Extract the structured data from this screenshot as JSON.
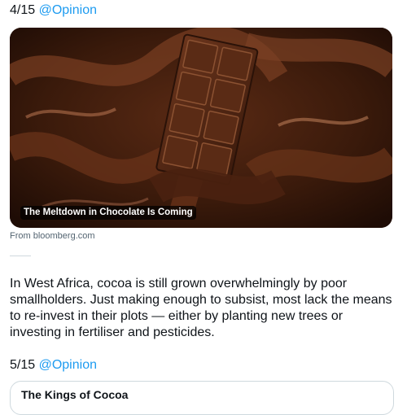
{
  "post4": {
    "index": "4/15",
    "mention": "@Opinion",
    "card_title": "The Meltdown in Chocolate Is Coming",
    "source": "From bloomberg.com",
    "image_icon": "chocolate-bar-image"
  },
  "body_text": "In West Africa, cocoa is still grown overwhelmingly by poor smallholders. Just making enough to subsist, most lack the means to re-invest in their plots — either by planting new trees or investing in fertiliser and pesticides.",
  "post5": {
    "index": "5/15",
    "mention": "@Opinion",
    "card_title": "The Kings of Cocoa"
  },
  "colors": {
    "link": "#1d9bf0",
    "text": "#0f1419",
    "muted": "#536471",
    "border": "#cfd9de"
  }
}
